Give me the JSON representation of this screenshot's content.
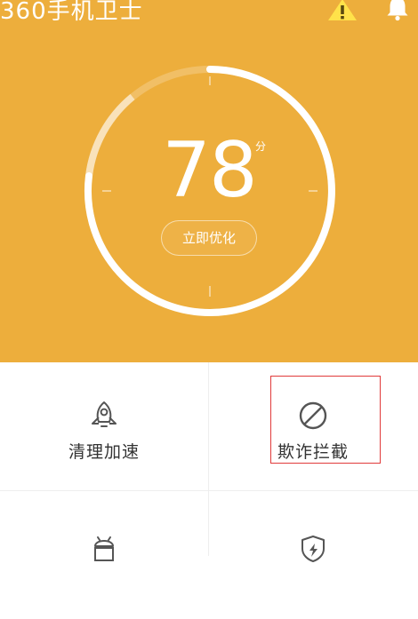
{
  "header": {
    "app_title": "360手机卫士",
    "warning_icon": "warning-triangle-icon",
    "bell_icon": "bell-icon",
    "background_color": "#EDAE3C"
  },
  "score_panel": {
    "score": "78",
    "unit": "分",
    "optimize_label": "立即优化"
  },
  "tools": [
    {
      "label": "清理加速",
      "icon": "rocket-icon"
    },
    {
      "label": "欺诈拦截",
      "icon": "block-icon",
      "highlighted": true
    },
    {
      "label": "",
      "icon": "android-icon"
    },
    {
      "label": "",
      "icon": "shield-lightning-icon"
    }
  ],
  "colors": {
    "tile_text": "#333333",
    "icon_gray": "#555555",
    "highlight_border": "#E03A3A"
  }
}
